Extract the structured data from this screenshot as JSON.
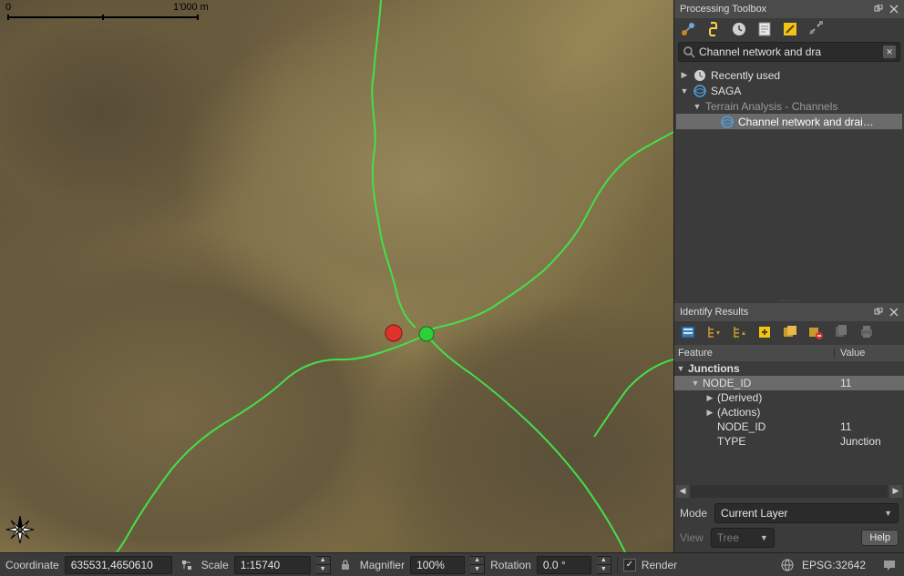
{
  "map": {
    "scale_bar": {
      "start": "0",
      "end": "1'000 m"
    }
  },
  "toolbox": {
    "title": "Processing Toolbox",
    "search_value": "Channel network and dra",
    "tree": {
      "recent": "Recently used",
      "saga": "SAGA",
      "group": "Terrain Analysis - Channels",
      "algo": "Channel network and drai…"
    }
  },
  "identify": {
    "title": "Identify Results",
    "columns": {
      "feature": "Feature",
      "value": "Value"
    },
    "rows": {
      "layer": "Junctions",
      "feature_name": "NODE_ID",
      "feature_val": "11",
      "derived": "(Derived)",
      "actions": "(Actions)",
      "node_id_name": "NODE_ID",
      "node_id_val": "11",
      "type_name": "TYPE",
      "type_val": "Junction"
    },
    "mode_label": "Mode",
    "mode_value": "Current Layer",
    "view_label": "View",
    "view_value": "Tree",
    "help": "Help"
  },
  "status": {
    "coord_label": "Coordinate",
    "coord_value": "635531,4650610",
    "scale_label": "Scale",
    "scale_value": "1:15740",
    "mag_label": "Magnifier",
    "mag_value": "100%",
    "rot_label": "Rotation",
    "rot_value": "0.0 °",
    "render": "Render",
    "crs": "EPSG:32642"
  }
}
